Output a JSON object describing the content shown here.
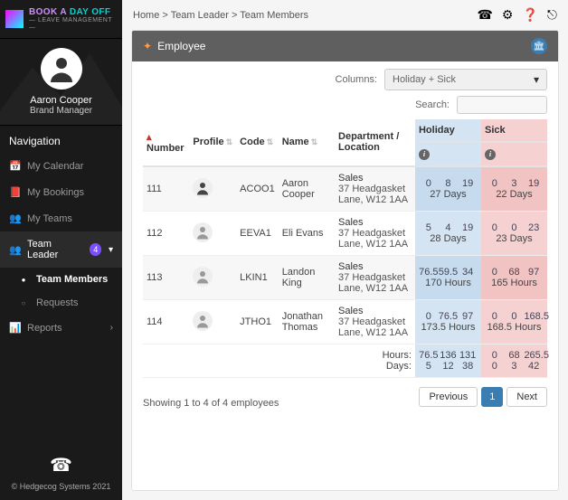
{
  "logo": {
    "line1a": "BOOK A ",
    "line1b": "DAY OFF",
    "line2": "— LEAVE MANAGEMENT —"
  },
  "profile": {
    "name": "Aaron Cooper",
    "role": "Brand Manager"
  },
  "nav": {
    "header": "Navigation",
    "items": [
      {
        "id": "cal",
        "icon": "📅",
        "label": "My Calendar"
      },
      {
        "id": "book",
        "icon": "📕",
        "label": "My Bookings"
      },
      {
        "id": "teams",
        "icon": "👥",
        "label": "My Teams"
      },
      {
        "id": "lead",
        "icon": "👥",
        "label": "Team Leader",
        "badge": "4",
        "expanded": true,
        "active": true,
        "sub": [
          {
            "id": "members",
            "label": "Team Members",
            "active": true
          },
          {
            "id": "requests",
            "label": "Requests"
          }
        ]
      },
      {
        "id": "reports",
        "icon": "📊",
        "label": "Reports",
        "chev": "›"
      }
    ]
  },
  "footer_copy": "© Hedgecog Systems 2021",
  "breadcrumbs": [
    "Home",
    "Team Leader",
    "Team Members"
  ],
  "panel_title": "Employee",
  "columns_label": "Columns:",
  "columns_value": "Holiday + Sick",
  "search_label": "Search:",
  "headers": {
    "number": "Number",
    "profile": "Profile",
    "code": "Code",
    "name": "Name",
    "dept": "Department / Location",
    "holiday": "Holiday",
    "sick": "Sick"
  },
  "rows": [
    {
      "num": "111",
      "code": "ACOO1",
      "name": "Aaron Cooper",
      "dept": "Sales",
      "loc": "37 Headgasket Lane, W12 1AA",
      "hol": [
        "0",
        "8",
        "19"
      ],
      "hol_u": "27 Days",
      "sick": [
        "0",
        "3",
        "19"
      ],
      "sick_u": "22 Days",
      "photo": true
    },
    {
      "num": "112",
      "code": "EEVA1",
      "name": "Eli Evans",
      "dept": "Sales",
      "loc": "37 Headgasket Lane, W12 1AA",
      "hol": [
        "5",
        "4",
        "19"
      ],
      "hol_u": "28 Days",
      "sick": [
        "0",
        "0",
        "23"
      ],
      "sick_u": "23 Days"
    },
    {
      "num": "113",
      "code": "LKIN1",
      "name": "Landon King",
      "dept": "Sales",
      "loc": "37 Headgasket Lane, W12 1AA",
      "hol": [
        "76.5",
        "59.5",
        "34"
      ],
      "hol_u": "170 Hours",
      "sick": [
        "0",
        "68",
        "97"
      ],
      "sick_u": "165 Hours"
    },
    {
      "num": "114",
      "code": "JTHO1",
      "name": "Jonathan Thomas",
      "dept": "Sales",
      "loc": "37 Headgasket Lane, W12 1AA",
      "hol": [
        "0",
        "76.5",
        "97"
      ],
      "hol_u": "173.5 Hours",
      "sick": [
        "0",
        "0",
        "168.5"
      ],
      "sick_u": "168.5 Hours"
    }
  ],
  "totals": {
    "hours_label": "Hours:",
    "days_label": "Days:",
    "hol_hours": [
      "76.5",
      "136",
      "131"
    ],
    "hol_days": [
      "5",
      "12",
      "38"
    ],
    "sick_hours": [
      "0",
      "68",
      "265.5"
    ],
    "sick_days": [
      "0",
      "3",
      "42"
    ]
  },
  "showing": "Showing 1 to 4 of 4  employees",
  "pager": {
    "prev": "Previous",
    "page": "1",
    "next": "Next"
  }
}
